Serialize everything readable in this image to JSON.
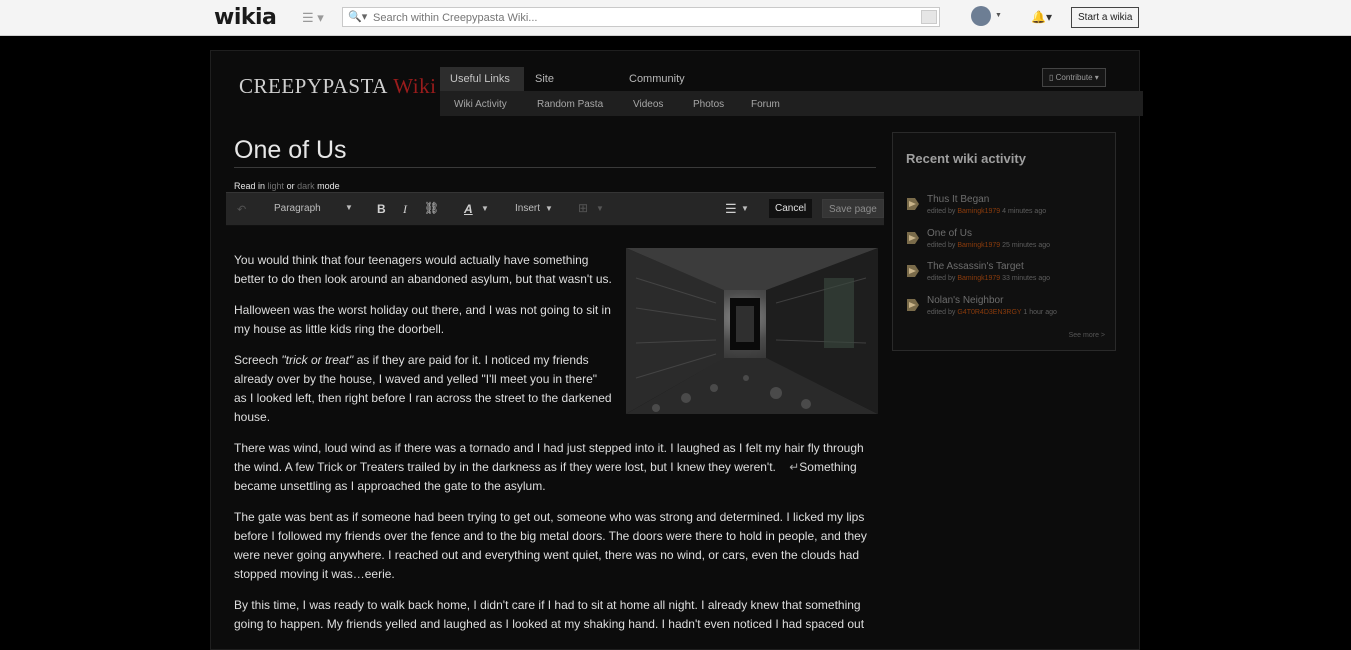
{
  "topbar": {
    "logo": "wikia",
    "search_placeholder": "Search within Creepypasta Wiki...",
    "start_wiki_label": "Start a wikia"
  },
  "wiki": {
    "logo_part1": "Creepypasta",
    "logo_part2": "Wiki",
    "tabs": [
      "Useful Links",
      "Site Navigation",
      "Community"
    ],
    "subnav": [
      "Wiki Activity",
      "Random Pasta",
      "Videos",
      "Photos",
      "Forum"
    ],
    "contribute_label": "Contribute"
  },
  "page": {
    "title": "One of Us",
    "read_prefix": "Read in",
    "light_label": "light",
    "or_label": "or",
    "dark_label": "dark",
    "mode_label": "mode"
  },
  "editor": {
    "paragraph_label": "Paragraph",
    "bold_label": "B",
    "italic_label": "I",
    "text_style_label": "A",
    "insert_label": "Insert",
    "cancel_label": "Cancel",
    "save_label": "Save page"
  },
  "article": {
    "p1": "You would think that four teenagers would actually have something better to do then look around an abandoned asylum, but that wasn't us.",
    "p2": "Halloween was the worst holiday out there, and I was not going to sit in my house as little kids ring the doorbell.",
    "p3_pre": "Screech ",
    "p3_em": "\"trick or treat\"",
    "p3_post": " as if they are paid for it. I noticed my friends already over by the house, I waved and yelled \"I'll meet you in there\" as I looked left, then right before I ran across the street to the darkened house.",
    "p4_a": "There was wind, loud wind as if there was a tornado and I had just stepped into it. I laughed as I felt my hair fly through the wind. A few Trick or Treaters trailed by in the darkness as if they were lost, but I knew they weren't.",
    "p4_b": "Something became unsettling as I approached the gate to the asylum.",
    "p5": "The gate was bent as if someone had been trying to get out, someone who was strong and determined. I licked my lips before I followed my friends over the fence and to the big metal doors. The doors were there to hold in people, and they were never going anywhere. I reached out and everything went quiet, there was no wind, or cars, even the clouds had stopped moving it was…eerie.",
    "p6": "By this time, I was ready to walk back home, I didn't care if I had to sit at home all night. I already knew that something going to happen. My friends yelled and laughed as I looked at my shaking hand. I hadn't even noticed I had spaced out"
  },
  "activity": {
    "heading": "Recent wiki activity",
    "items": [
      {
        "title": "Thus It Began",
        "edited_by": "edited by",
        "user": "Bamingk1979",
        "time": "4 minutes ago"
      },
      {
        "title": "One of Us",
        "edited_by": "edited by",
        "user": "Bamingk1979",
        "time": "25 minutes ago"
      },
      {
        "title": "The Assassin's Target",
        "edited_by": "edited by",
        "user": "Bamingk1979",
        "time": "33 minutes ago"
      },
      {
        "title": "Nolan's Neighbor",
        "edited_by": "edited by",
        "user": "G4T0R4D3EN3RGY",
        "time": "1 hour ago"
      }
    ],
    "see_more": "See more >"
  },
  "colors": {
    "background": "#000000",
    "topbar": "#f4f4f4",
    "toolbar": "#262626",
    "wiki_red": "#9a1c1c",
    "username": "#8a3b0c"
  }
}
